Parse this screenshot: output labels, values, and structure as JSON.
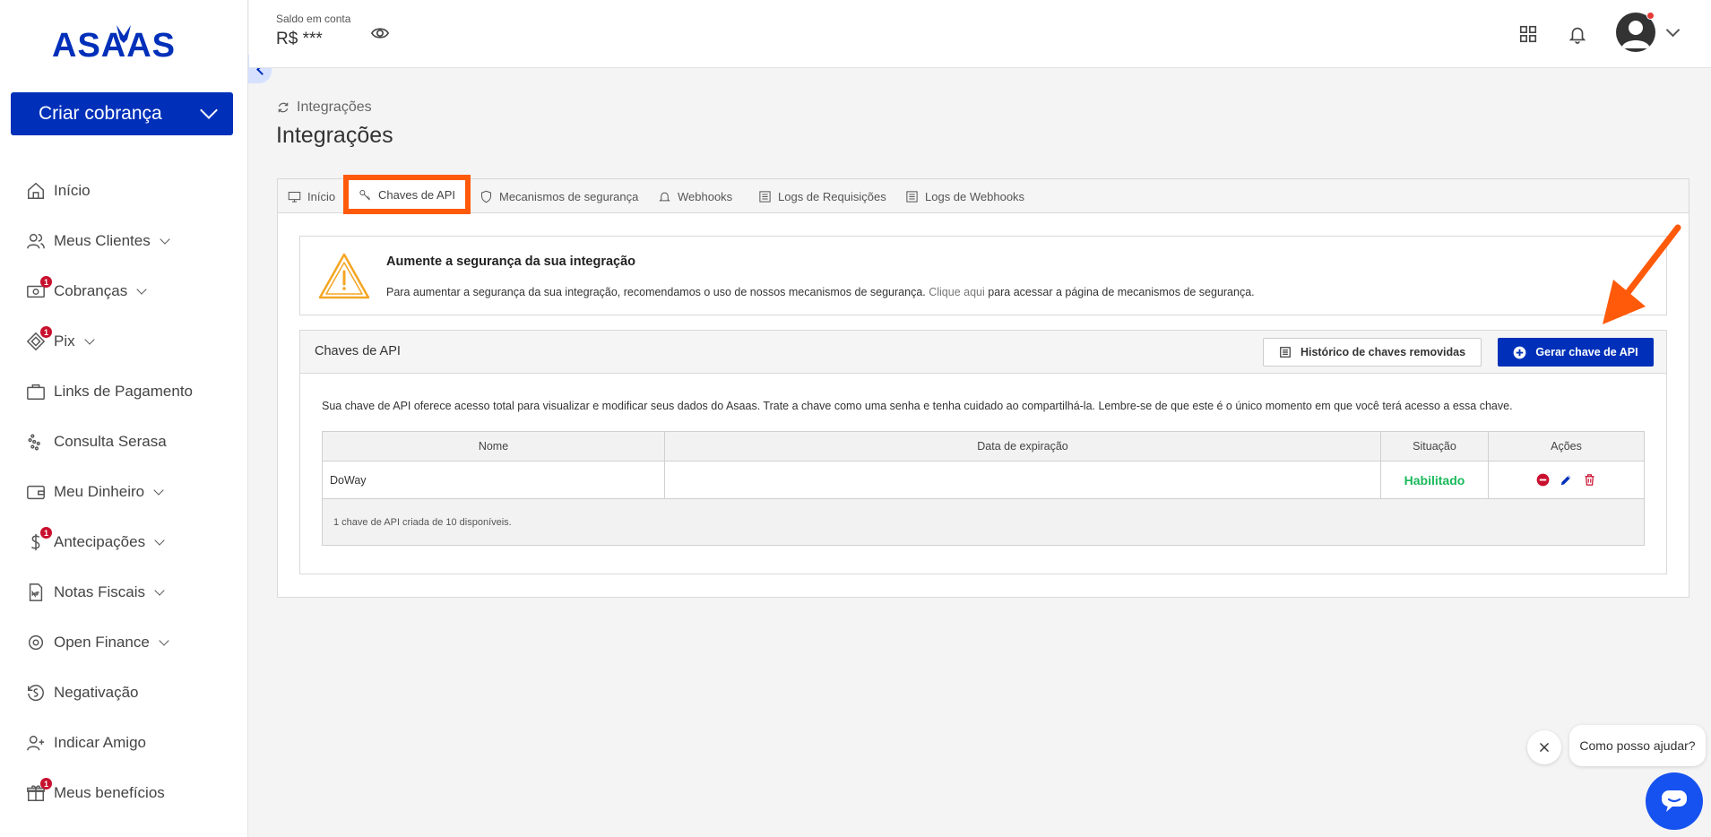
{
  "sidebar": {
    "logo": "ASAAS",
    "create_button": "Criar cobrança",
    "items": [
      {
        "label": "Início",
        "icon": "home-icon",
        "badge": "",
        "chevron": false
      },
      {
        "label": "Meus Clientes",
        "icon": "users-icon",
        "badge": "",
        "chevron": true
      },
      {
        "label": "Cobranças",
        "icon": "money-icon",
        "badge": "1",
        "chevron": true
      },
      {
        "label": "Pix",
        "icon": "pix-icon",
        "badge": "1",
        "chevron": true
      },
      {
        "label": "Links de Pagamento",
        "icon": "briefcase-icon",
        "badge": "",
        "chevron": false
      },
      {
        "label": "Consulta Serasa",
        "icon": "serasa-icon",
        "badge": "",
        "chevron": false
      },
      {
        "label": "Meu Dinheiro",
        "icon": "wallet-icon",
        "badge": "",
        "chevron": true
      },
      {
        "label": "Antecipações",
        "icon": "dollar-icon",
        "badge": "1",
        "chevron": true
      },
      {
        "label": "Notas Fiscais",
        "icon": "invoice-icon",
        "badge": "",
        "chevron": true
      },
      {
        "label": "Open Finance",
        "icon": "open-finance-icon",
        "badge": "",
        "chevron": true
      },
      {
        "label": "Negativação",
        "icon": "negativacao-icon",
        "badge": "",
        "chevron": false
      },
      {
        "label": "Indicar Amigo",
        "icon": "add-user-icon",
        "badge": "",
        "chevron": false
      },
      {
        "label": "Meus benefícios",
        "icon": "gift-icon",
        "badge": "1",
        "chevron": false
      }
    ]
  },
  "header": {
    "balance_label": "Saldo em conta",
    "balance_value": "R$ ***"
  },
  "main": {
    "breadcrumb": "Integrações",
    "title": "Integrações",
    "tabs": [
      {
        "label": "Início",
        "icon": "monitor-icon"
      },
      {
        "label": "Chaves de API",
        "icon": "key-icon"
      },
      {
        "label": "Mecanismos de segurança",
        "icon": "shield-icon"
      },
      {
        "label": "Webhooks",
        "icon": "bell-icon"
      },
      {
        "label": "Logs de Requisições",
        "icon": "list-icon"
      },
      {
        "label": "Logs de Webhooks",
        "icon": "list-icon"
      }
    ],
    "alert": {
      "title": "Aumente a segurança da sua integração",
      "text_before": "Para aumentar a segurança da sua integração, recomendamos o uso de nossos mecanismos de segurança. ",
      "link": "Clique aqui",
      "text_after": " para acessar a página de mecanismos de segurança."
    },
    "keys": {
      "title": "Chaves de API",
      "history_button": "Histórico de chaves removidas",
      "generate_button": "Gerar chave de API",
      "description": "Sua chave de API oferece acesso total para visualizar e modificar seus dados do Asaas. Trate a chave como uma senha e tenha cuidado ao compartilhá-la. Lembre-se de que este é o único momento em que você terá acesso a essa chave.",
      "columns": [
        "Nome",
        "Data de expiração",
        "Situação",
        "Ações"
      ],
      "rows": [
        {
          "name": "DoWay",
          "expiration": "",
          "status": "Habilitado"
        }
      ],
      "footer": "1 chave de API criada de 10 disponíveis."
    }
  },
  "chat": {
    "bubble": "Como posso ajudar?"
  },
  "colors": {
    "brand": "#0030b9",
    "highlight": "#ff5a0a",
    "status_ok": "#19b95a",
    "danger": "#c8102e"
  }
}
